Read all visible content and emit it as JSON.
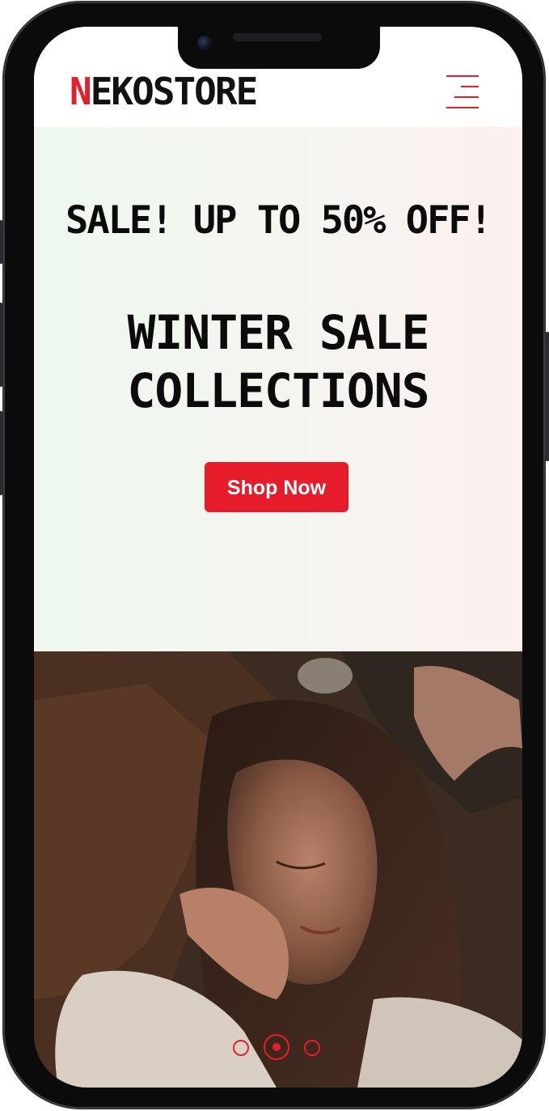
{
  "header": {
    "logo_first": "N",
    "logo_rest": "EKOSTORE"
  },
  "hero": {
    "sale_text": "SALE! UP TO 50% OFF!",
    "headline_line1": "WINTER SALE",
    "headline_line2": "COLLECTIONS",
    "cta_label": "Shop Now"
  },
  "carousel": {
    "slide_count": 3,
    "active_index": 1
  },
  "icons": {
    "menu": "hamburger-menu-icon"
  },
  "colors": {
    "brand_red": "#e41e2b",
    "text_dark": "#0b0b0b"
  }
}
